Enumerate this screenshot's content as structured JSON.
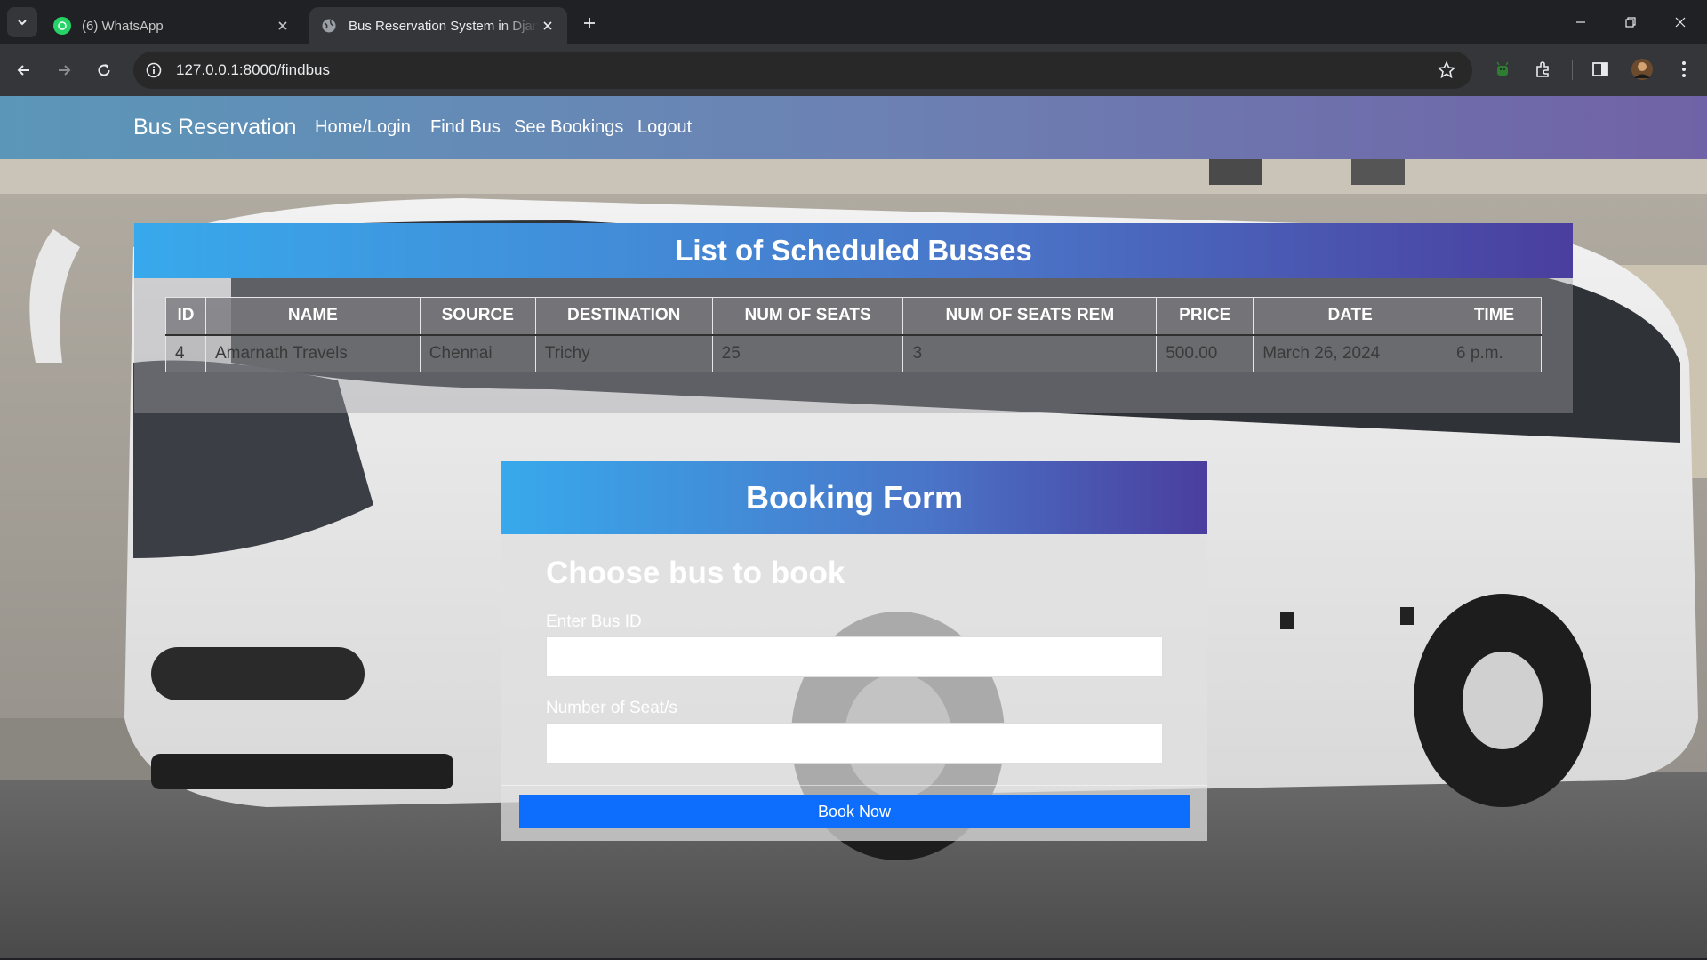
{
  "browser": {
    "tabs": [
      {
        "title": "(6) WhatsApp",
        "active": false
      },
      {
        "title": "Bus Reservation System in Django",
        "active": true
      }
    ],
    "url": "127.0.0.1:8000/findbus"
  },
  "navbar": {
    "brand": "Bus Reservation",
    "links": [
      "Home/Login",
      "Find Bus",
      "See Bookings",
      "Logout"
    ]
  },
  "bus_list": {
    "title": "List of Scheduled Busses",
    "columns": [
      "ID",
      "NAME",
      "SOURCE",
      "DESTINATION",
      "NUM OF SEATS",
      "NUM OF SEATS REM",
      "PRICE",
      "DATE",
      "TIME"
    ],
    "rows": [
      [
        "4",
        "Amarnath Travels",
        "Chennai",
        "Trichy",
        "25",
        "3",
        "500.00",
        "March 26, 2024",
        "6 p.m."
      ]
    ]
  },
  "booking_form": {
    "title": "Booking Form",
    "subtitle": "Choose bus to book",
    "bus_id_label": "Enter Bus ID",
    "bus_id_value": "",
    "seats_label": "Number of Seat/s",
    "seats_value": "",
    "submit_label": "Book Now"
  },
  "colors": {
    "chrome_bg": "#202124",
    "navbar_gradient": [
      "#5b96b8",
      "#7062a6"
    ],
    "card_header_gradient": [
      "#38a9ec",
      "#4a3e9e"
    ],
    "primary_button": "#0d6efd"
  }
}
